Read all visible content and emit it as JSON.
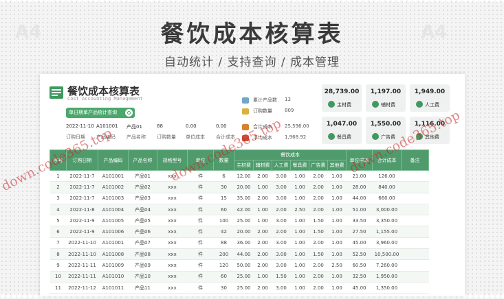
{
  "hero": {
    "title": "餐饮成本核算表",
    "subtitle": "自动统计 / 支持查询 / 成本管理"
  },
  "sheet": {
    "title": "餐饮成本核算表",
    "subtitle": "Cost Accounting Management",
    "filter_button": "单日期单产品统计查询",
    "query_values": [
      "2022-11-10",
      "A101001",
      "产品01",
      "88",
      "0.00",
      "0.00"
    ],
    "query_labels": [
      "订购日期",
      "产品编码",
      "产品名称",
      "订购数量",
      "单位成本",
      "合计成本"
    ],
    "stats": [
      {
        "label": "累计产品数",
        "value": "13",
        "color": "#6fa8c8"
      },
      {
        "label": "订购数量",
        "value": "809",
        "color": "#d9b23a"
      },
      {
        "label": "合计成本",
        "value": "25,596.00",
        "color": "#d8822a"
      },
      {
        "label": "平均成本",
        "value": "1,968.92",
        "color": "#c8503a"
      }
    ],
    "cards": [
      {
        "value": "28,739.00",
        "label": "主材费"
      },
      {
        "value": "1,197.00",
        "label": "辅材费"
      },
      {
        "value": "1,949.00",
        "label": "人工费"
      },
      {
        "value": "1,047.00",
        "label": "餐具费"
      },
      {
        "value": "1,550.00",
        "label": "广告费"
      },
      {
        "value": "1,116.00",
        "label": "其他费"
      }
    ],
    "table": {
      "headers": [
        "序号",
        "订购日期",
        "产品编码",
        "产品名称",
        "规格型号",
        "单位",
        "数量",
        "餐饮成本",
        "单位成本",
        "合计成本",
        "备注"
      ],
      "sub_headers": [
        "主材费",
        "辅材费",
        "人工费",
        "餐具费",
        "广告费",
        "其他费"
      ],
      "rows": [
        [
          "1",
          "2022-11-7",
          "A101001",
          "产品01",
          "xxx",
          "件",
          "6",
          "12.00",
          "2.00",
          "3.00",
          "1.00",
          "2.00",
          "1.00",
          "21.00",
          "126.00",
          ""
        ],
        [
          "2",
          "2022-11-7",
          "A101002",
          "产品02",
          "xxx",
          "件",
          "30",
          "20.00",
          "1.00",
          "3.00",
          "1.00",
          "2.00",
          "1.00",
          "28.00",
          "840.00",
          ""
        ],
        [
          "3",
          "2022-11-7",
          "A101003",
          "产品03",
          "xxx",
          "件",
          "15",
          "35.00",
          "2.00",
          "3.00",
          "1.00",
          "2.00",
          "1.00",
          "44.00",
          "660.00",
          ""
        ],
        [
          "4",
          "2022-11-8",
          "A101004",
          "产品04",
          "xxx",
          "件",
          "60",
          "42.00",
          "1.00",
          "2.00",
          "2.50",
          "2.00",
          "1.00",
          "51.00",
          "3,000.00",
          ""
        ],
        [
          "5",
          "2022-11-9",
          "A101005",
          "产品05",
          "xxx",
          "件",
          "100",
          "25.00",
          "1.00",
          "3.00",
          "1.00",
          "1.50",
          "1.00",
          "33.50",
          "3,350.00",
          ""
        ],
        [
          "6",
          "2022-11-9",
          "A101006",
          "产品06",
          "xxx",
          "件",
          "42",
          "20.00",
          "2.00",
          "2.00",
          "1.00",
          "1.50",
          "1.00",
          "27.50",
          "1,155.00",
          ""
        ],
        [
          "7",
          "2022-11-10",
          "A101001",
          "产品07",
          "xxx",
          "件",
          "88",
          "36.00",
          "2.00",
          "3.00",
          "1.00",
          "2.00",
          "1.00",
          "45.00",
          "3,960.00",
          ""
        ],
        [
          "8",
          "2022-11-10",
          "A101008",
          "产品08",
          "xxx",
          "件",
          "200",
          "44.00",
          "2.00",
          "3.00",
          "1.00",
          "1.50",
          "1.00",
          "52.50",
          "10,500.00",
          ""
        ],
        [
          "9",
          "2022-11-11",
          "A101009",
          "产品09",
          "xxx",
          "件",
          "120",
          "50.00",
          "2.00",
          "3.00",
          "1.00",
          "2.00",
          "2.50",
          "60.50",
          "7,260.00",
          ""
        ],
        [
          "10",
          "2022-11-11",
          "A101010",
          "产品10",
          "xxx",
          "件",
          "60",
          "25.00",
          "1.00",
          "1.50",
          "1.00",
          "2.00",
          "1.00",
          "32.50",
          "1,950.00",
          ""
        ],
        [
          "11",
          "2022-11-12",
          "A101011",
          "产品11",
          "xxx",
          "件",
          "30",
          "25.00",
          "2.00",
          "3.00",
          "1.00",
          "2.00",
          "1.00",
          "45.00",
          "1,350.00",
          ""
        ]
      ]
    }
  },
  "watermark": "down.code365.top"
}
